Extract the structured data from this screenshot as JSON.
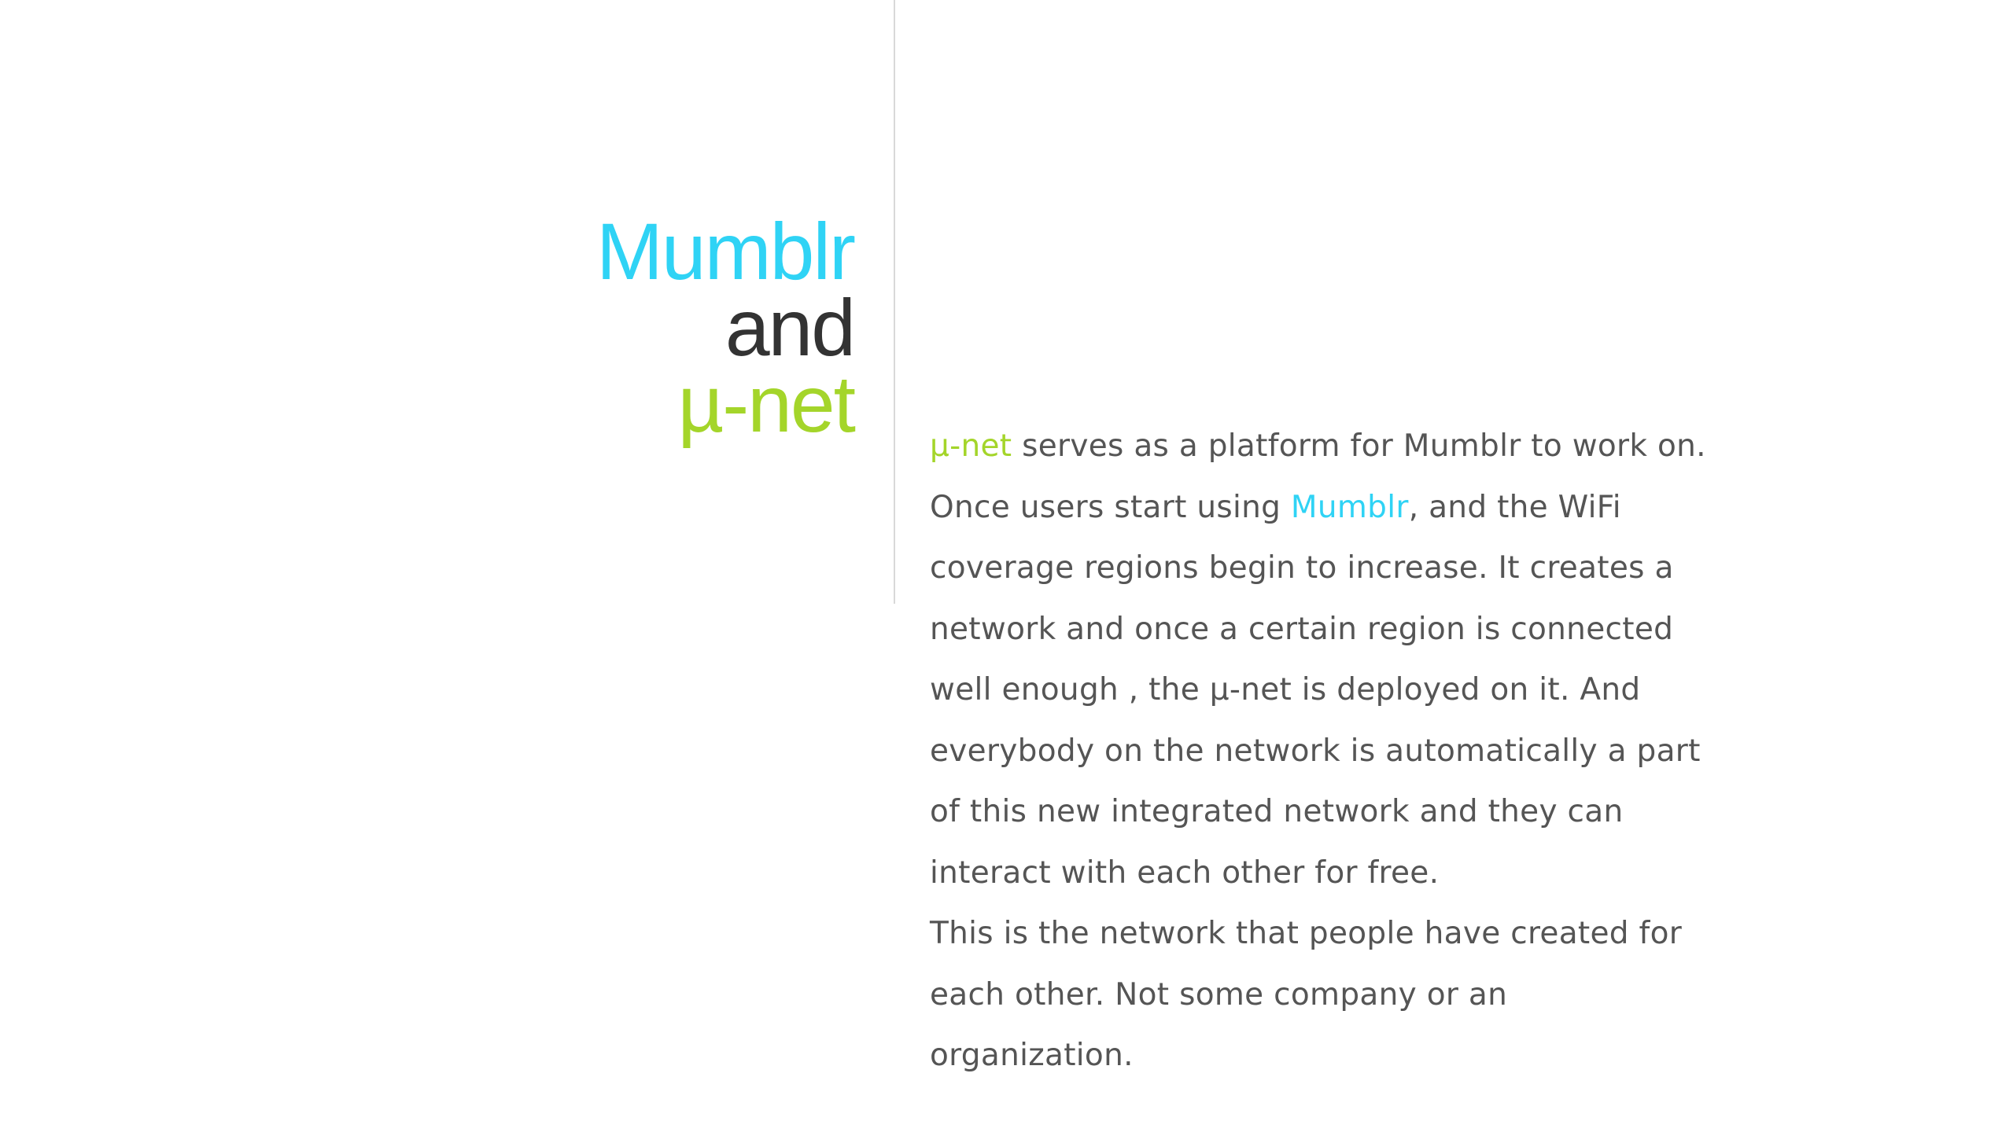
{
  "title": {
    "line1": "Mumblr",
    "line2": "and",
    "line3": "µ-net"
  },
  "body": {
    "p1_highlight_unet": "µ-net",
    "p1_text_a": " serves as a platform for Mumblr to work on. Once users start using ",
    "p1_highlight_mumblr": "Mumblr",
    "p1_text_b": ", and the WiFi coverage regions begin to increase. It creates a network and once a certain region is connected well enough , the µ-net is deployed on it. And everybody on the network is automatically a part of this new integrated network and they can interact with each other for free.",
    "p2_text": "This is the network that people have created for each other. Not some company or an organization."
  },
  "colors": {
    "mumblr": "#2fd3f5",
    "and": "#333333",
    "unet": "#a4d52a",
    "body_text": "#555555",
    "divider": "#d8d8d8"
  }
}
